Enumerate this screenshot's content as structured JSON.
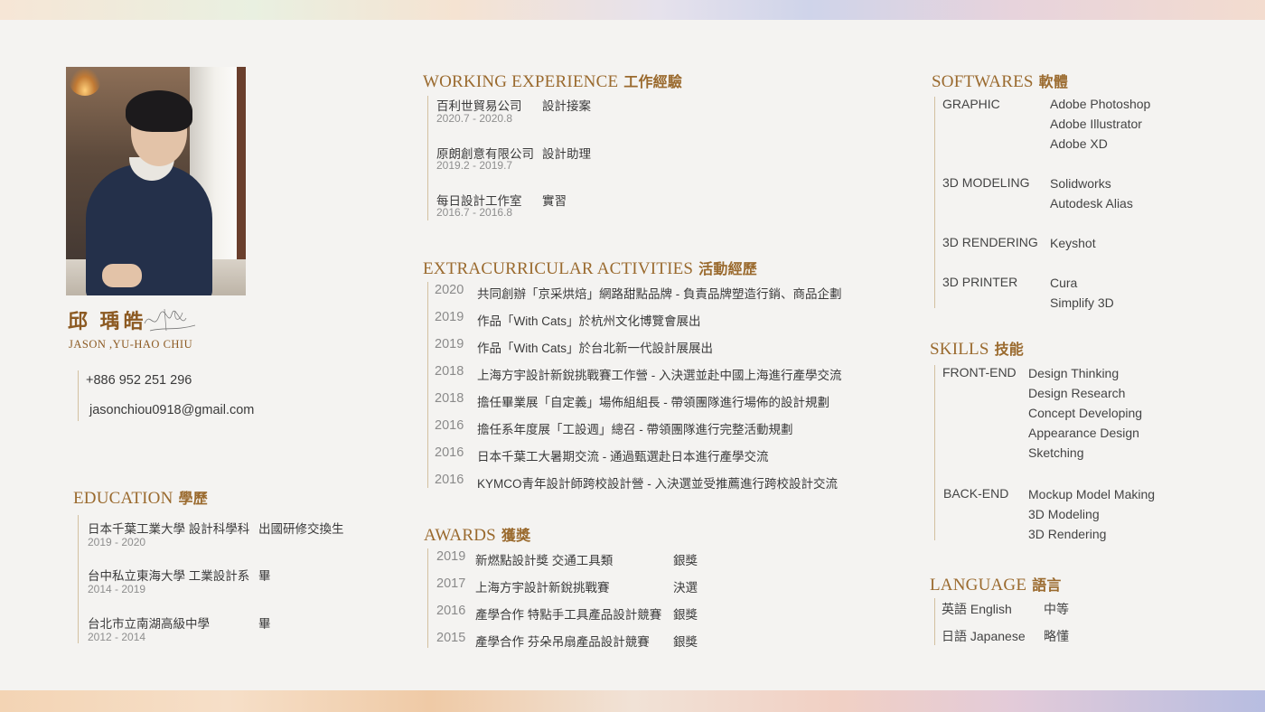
{
  "profile": {
    "name_cn": "邱 瑀皓",
    "name_en": "JASON ,YU-HAO CHIU",
    "phone": "+886 952 251 296",
    "email": "jasonchiou0918@gmail.com"
  },
  "education": {
    "title": "EDUCATION",
    "title_cn": "學歷",
    "items": [
      {
        "school": "日本千葉工業大學 設計科學科",
        "note": "出國研修交換生",
        "date": "2019 - 2020"
      },
      {
        "school": "台中私立東海大學 工業設計系",
        "note": "畢",
        "date": "2014 - 2019"
      },
      {
        "school": "台北市立南湖高級中學",
        "note": "畢",
        "date": "2012 - 2014"
      }
    ]
  },
  "work": {
    "title": "WORKING EXPERIENCE",
    "title_cn": "工作經驗",
    "items": [
      {
        "company": "百利世貿易公司",
        "role": "設計接案",
        "date": "2020.7 - 2020.8"
      },
      {
        "company": "原朗創意有限公司",
        "role": "設計助理",
        "date": "2019.2 - 2019.7"
      },
      {
        "company": "每日設計工作室",
        "role": "實習",
        "date": "2016.7 - 2016.8"
      }
    ]
  },
  "activities": {
    "title": "EXTRACURRICULAR ACTIVITIES",
    "title_cn": "活動經歷",
    "items": [
      {
        "year": "2020",
        "text": "共同創辦「京采烘焙」網路甜點品牌 - 負責品牌塑造行銷、商品企劃"
      },
      {
        "year": "2019",
        "text": "作品「With Cats」於杭州文化博覽會展出"
      },
      {
        "year": "2019",
        "text": "作品「With Cats」於台北新一代設計展展出"
      },
      {
        "year": "2018",
        "text": "上海方宇設計新銳挑戰賽工作營 - 入決選並赴中國上海進行產學交流"
      },
      {
        "year": "2018",
        "text": "擔任畢業展「自定義」場佈組組長 - 帶領團隊進行場佈的設計規劃"
      },
      {
        "year": "2016",
        "text": "擔任系年度展「工設週」總召 - 帶領團隊進行完整活動規劃"
      },
      {
        "year": "2016",
        "text": "日本千葉工大暑期交流 - 通過甄選赴日本進行產學交流"
      },
      {
        "year": "2016",
        "text": "KYMCO青年設計師跨校設計營 - 入決選並受推薦進行跨校設計交流"
      }
    ]
  },
  "awards": {
    "title": "AWARDS",
    "title_cn": "獲獎",
    "items": [
      {
        "year": "2019",
        "name": "新燃點設計獎 交通工具類",
        "result": "銀獎"
      },
      {
        "year": "2017",
        "name": "上海方宇設計新銳挑戰賽",
        "result": "決選"
      },
      {
        "year": "2016",
        "name": "產學合作 特點手工具產品設計競賽",
        "result": "銀獎"
      },
      {
        "year": "2015",
        "name": "產學合作 芬朵吊扇產品設計競賽",
        "result": "銀獎"
      }
    ]
  },
  "softwares": {
    "title": "SOFTWARES",
    "title_cn": "軟體",
    "groups": [
      {
        "category": "GRAPHIC",
        "items": [
          "Adobe Photoshop",
          "Adobe Illustrator",
          "Adobe XD"
        ]
      },
      {
        "category": "3D MODELING",
        "items": [
          "Solidworks",
          "Autodesk Alias"
        ]
      },
      {
        "category": "3D RENDERING",
        "items": [
          "Keyshot"
        ]
      },
      {
        "category": "3D PRINTER",
        "items": [
          "Cura",
          "Simplify 3D"
        ]
      }
    ]
  },
  "skills": {
    "title": "SKILLS",
    "title_cn": "技能",
    "groups": [
      {
        "category": "FRONT-END",
        "items": [
          "Design Thinking",
          "Design Research",
          "Concept Developing",
          "Appearance Design",
          "Sketching"
        ]
      },
      {
        "category": "BACK-END",
        "items": [
          "Mockup Model Making",
          "3D Modeling",
          "3D Rendering"
        ]
      }
    ]
  },
  "language": {
    "title": "LANGUAGE",
    "title_cn": "語言",
    "items": [
      {
        "name": "英語 English",
        "level": "中等"
      },
      {
        "name": "日語 Japanese",
        "level": "略懂"
      }
    ]
  },
  "colors": {
    "accent": "#9a6a2e",
    "divider": "#d3c0a0",
    "background": "#f4f3f1"
  }
}
